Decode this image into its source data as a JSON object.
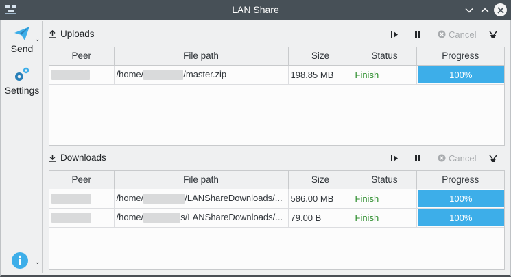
{
  "window": {
    "title": "LAN Share"
  },
  "sidebar": {
    "send_label": "Send",
    "settings_label": "Settings"
  },
  "uploads": {
    "title": "Uploads",
    "cancel_label": "Cancel",
    "columns": [
      "Peer",
      "File path",
      "Size",
      "Status",
      "Progress"
    ],
    "rows": [
      {
        "path_prefix": "/home/",
        "path_suffix": "/master.zip",
        "size": "198.85 MB",
        "status": "Finish",
        "progress": "100%"
      }
    ]
  },
  "downloads": {
    "title": "Downloads",
    "cancel_label": "Cancel",
    "columns": [
      "Peer",
      "File path",
      "Size",
      "Status",
      "Progress"
    ],
    "rows": [
      {
        "path_prefix": "/home/",
        "path_suffix": "/LANShareDownloads/...",
        "size": "586.00 MB",
        "status": "Finish",
        "progress": "100%"
      },
      {
        "path_prefix": "/home/",
        "path_suffix": "s/LANShareDownloads/...",
        "size": "79.00 B",
        "status": "Finish",
        "progress": "100%"
      }
    ]
  },
  "colors": {
    "accent": "#3daee9",
    "finish": "#2b8d2b",
    "titlebar": "#475057"
  },
  "icons": [
    "lanshare-app-icon",
    "minimize-icon",
    "maximize-icon",
    "close-icon",
    "send-paper-plane-icon",
    "settings-gears-icon",
    "info-icon",
    "upload-icon",
    "download-icon",
    "resume-icon",
    "pause-icon",
    "cancel-icon",
    "clear-broom-icon"
  ]
}
